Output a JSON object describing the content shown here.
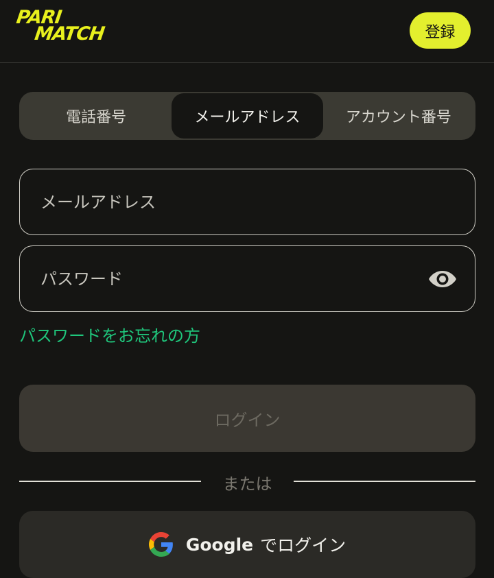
{
  "header": {
    "logo_line1": "PARI",
    "logo_line2": "MATCH",
    "register_label": "登録"
  },
  "tabs": [
    {
      "label": "電話番号",
      "active": false
    },
    {
      "label": "メールアドレス",
      "active": true
    },
    {
      "label": "アカウント番号",
      "active": false
    }
  ],
  "form": {
    "email_placeholder": "メールアドレス",
    "email_value": "",
    "password_placeholder": "パスワード",
    "password_value": "",
    "forgot_label": "パスワードをお忘れの方",
    "login_label": "ログイン"
  },
  "divider_label": "または",
  "google": {
    "brand": "Google",
    "suffix": "でログイン"
  },
  "colors": {
    "brand_yellow": "#e3ef2e",
    "link_green": "#1fc67c",
    "background": "#151513"
  }
}
